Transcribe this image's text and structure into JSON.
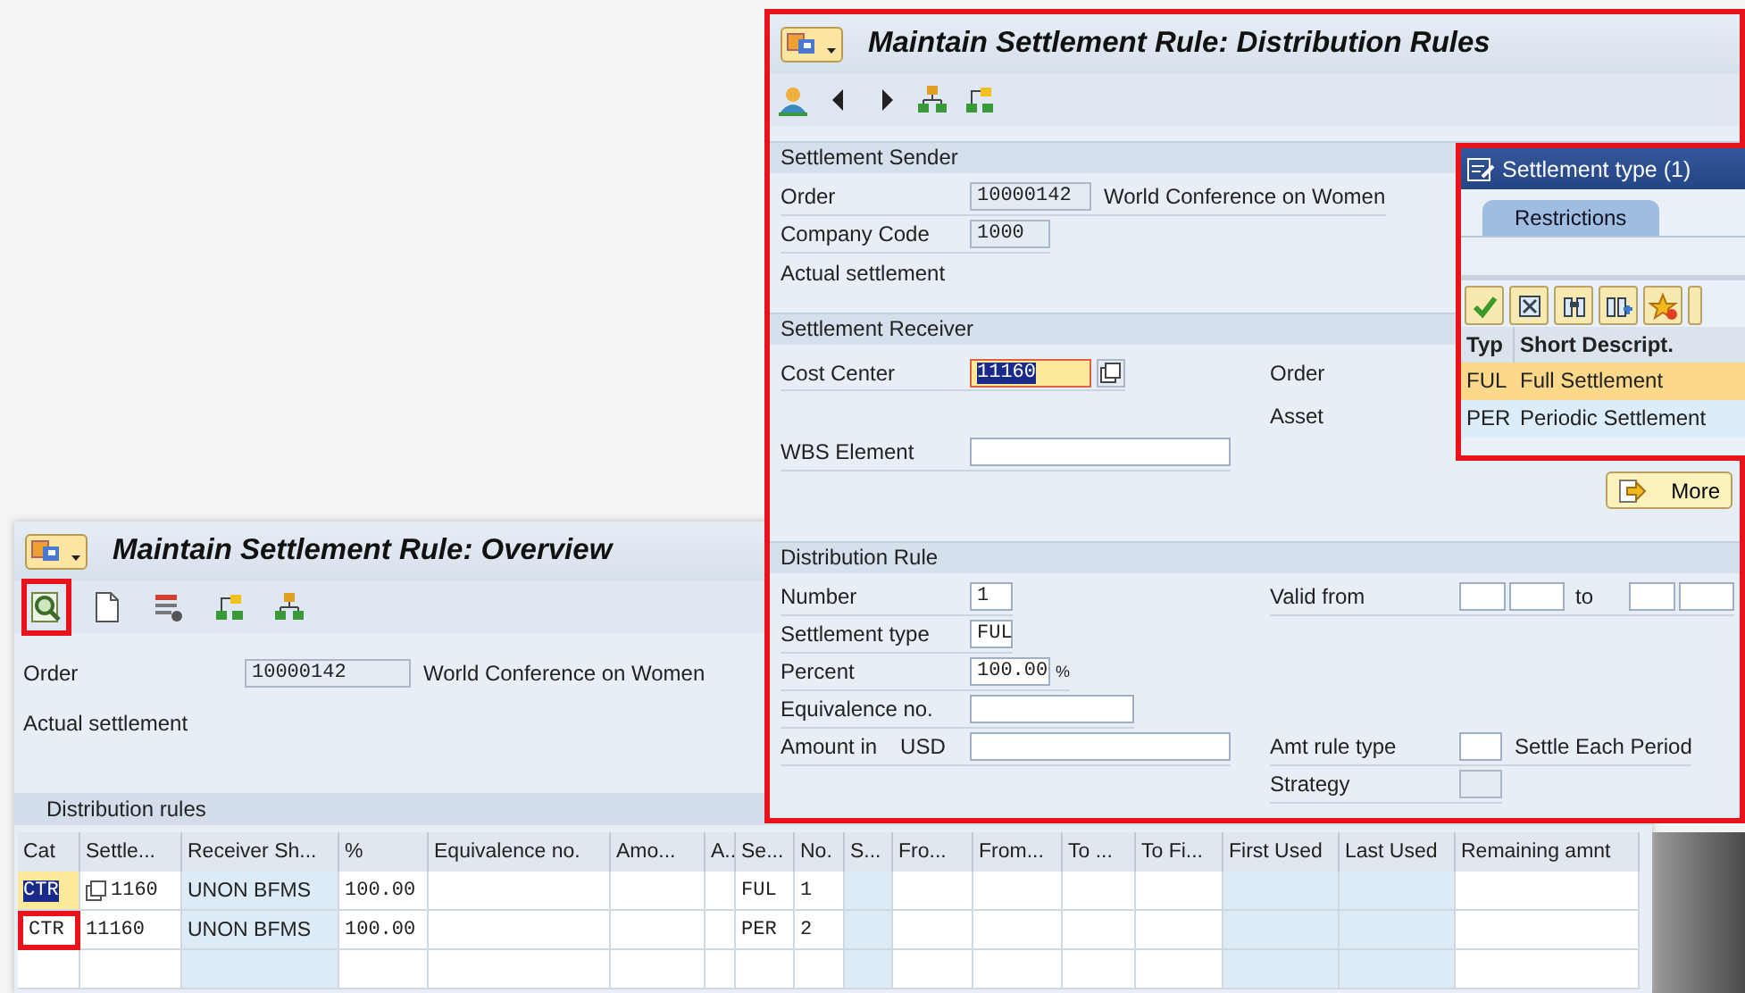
{
  "overview": {
    "title": "Maintain Settlement Rule: Overview",
    "toolbar": [
      {
        "kind": "detail",
        "highlighted": true
      },
      {
        "kind": "document",
        "highlighted": false
      },
      {
        "kind": "list",
        "highlighted": false
      },
      {
        "kind": "hierarchy_right",
        "highlighted": false
      },
      {
        "kind": "hierarchy",
        "highlighted": false
      }
    ],
    "order": {
      "label": "Order",
      "value": "10000142",
      "description": "World Conference on Women"
    },
    "status": "Actual settlement",
    "table": {
      "title": "Distribution rules",
      "columns": [
        {
          "label": "Cat",
          "editable": true
        },
        {
          "label": "Settle...",
          "editable": true
        },
        {
          "label": "Receiver Sh...",
          "editable": false
        },
        {
          "label": "%",
          "editable": true
        },
        {
          "label": "Equivalence no.",
          "editable": true
        },
        {
          "label": "Amo...",
          "editable": true
        },
        {
          "label": "A..",
          "editable": true
        },
        {
          "label": "Se...",
          "editable": true
        },
        {
          "label": "No.",
          "editable": true
        },
        {
          "label": "S...",
          "editable": false
        },
        {
          "label": "Fro...",
          "editable": true
        },
        {
          "label": "From...",
          "editable": true
        },
        {
          "label": "To ...",
          "editable": true
        },
        {
          "label": "To Fi...",
          "editable": true
        },
        {
          "label": "First Used",
          "editable": false
        },
        {
          "label": "Last Used",
          "editable": false
        },
        {
          "label": "Remaining amnt",
          "editable": true
        }
      ],
      "rows": [
        {
          "cat": "CTR",
          "receiver": "1160",
          "value_help": true,
          "short_text": "UNON BFMS",
          "percent": "100.00",
          "type": "FUL",
          "number": "1",
          "cat_selected": true,
          "cat_marked": false
        },
        {
          "cat": "CTR",
          "receiver": "11160",
          "value_help": false,
          "short_text": "UNON BFMS",
          "percent": "100.00",
          "type": "PER",
          "number": "2",
          "cat_selected": false,
          "cat_marked": true
        },
        {
          "value_help": false,
          "cat_selected": false,
          "cat_marked": false
        }
      ]
    }
  },
  "detail": {
    "title": "Maintain Settlement Rule: Distribution Rules",
    "toolbar": [
      {
        "kind": "person"
      },
      {
        "kind": "previous"
      },
      {
        "kind": "next"
      },
      {
        "kind": "hierarchy"
      },
      {
        "kind": "hierarchy_right"
      }
    ],
    "sections": [
      {
        "heading": "Settlement Sender",
        "rows": [
          {
            "left": {
              "label": "Order",
              "value": "10000142",
              "kind": "display",
              "after": "World Conference on Women"
            }
          },
          {
            "left": {
              "label": "Company Code",
              "value": "1000",
              "kind": "display"
            }
          },
          {
            "left": {
              "label": "Actual settlement",
              "kind": "text"
            }
          }
        ]
      },
      {
        "heading": "Settlement Receiver",
        "rows": [
          {
            "left": {
              "label": "Cost Center",
              "value": "11160",
              "kind": "focused",
              "selected": true,
              "value_help": true
            },
            "right": {
              "label": "Order",
              "kind": "text"
            }
          },
          {
            "right": {
              "label": "Asset",
              "kind": "text"
            }
          },
          {
            "left": {
              "label": "WBS Element",
              "kind": "input"
            }
          }
        ],
        "button": "More"
      },
      {
        "heading": "Distribution Rule",
        "rows": [
          {
            "left": {
              "label": "Number",
              "value": "1",
              "kind": "input"
            },
            "right": {
              "label": "Valid from",
              "kind": "date_range",
              "to": "to"
            }
          },
          {
            "left": {
              "label": "Settlement type",
              "value": "FUL",
              "kind": "input"
            }
          },
          {
            "left": {
              "label": "Percent",
              "value": "100.00",
              "kind": "input",
              "after": "%"
            }
          },
          {
            "left": {
              "label": "Equivalence no.",
              "kind": "input"
            }
          },
          {
            "left": {
              "label": "Amount in",
              "unit": "USD",
              "kind": "input"
            },
            "right": {
              "label": "Amt rule type",
              "kind": "input",
              "after": "Settle Each Period"
            }
          },
          {
            "right": {
              "label": "Strategy",
              "kind": "display"
            }
          }
        ]
      }
    ]
  },
  "popup": {
    "title": "Settlement type (1)",
    "tab": {
      "label": "Restrictions",
      "selected": true
    },
    "columns": [
      "Typ",
      "Short Descript."
    ],
    "rows": [
      {
        "type": "FUL",
        "text": "Full Settlement",
        "selected": true
      },
      {
        "type": "PER",
        "text": "Periodic Settlement",
        "selected": false
      }
    ]
  }
}
